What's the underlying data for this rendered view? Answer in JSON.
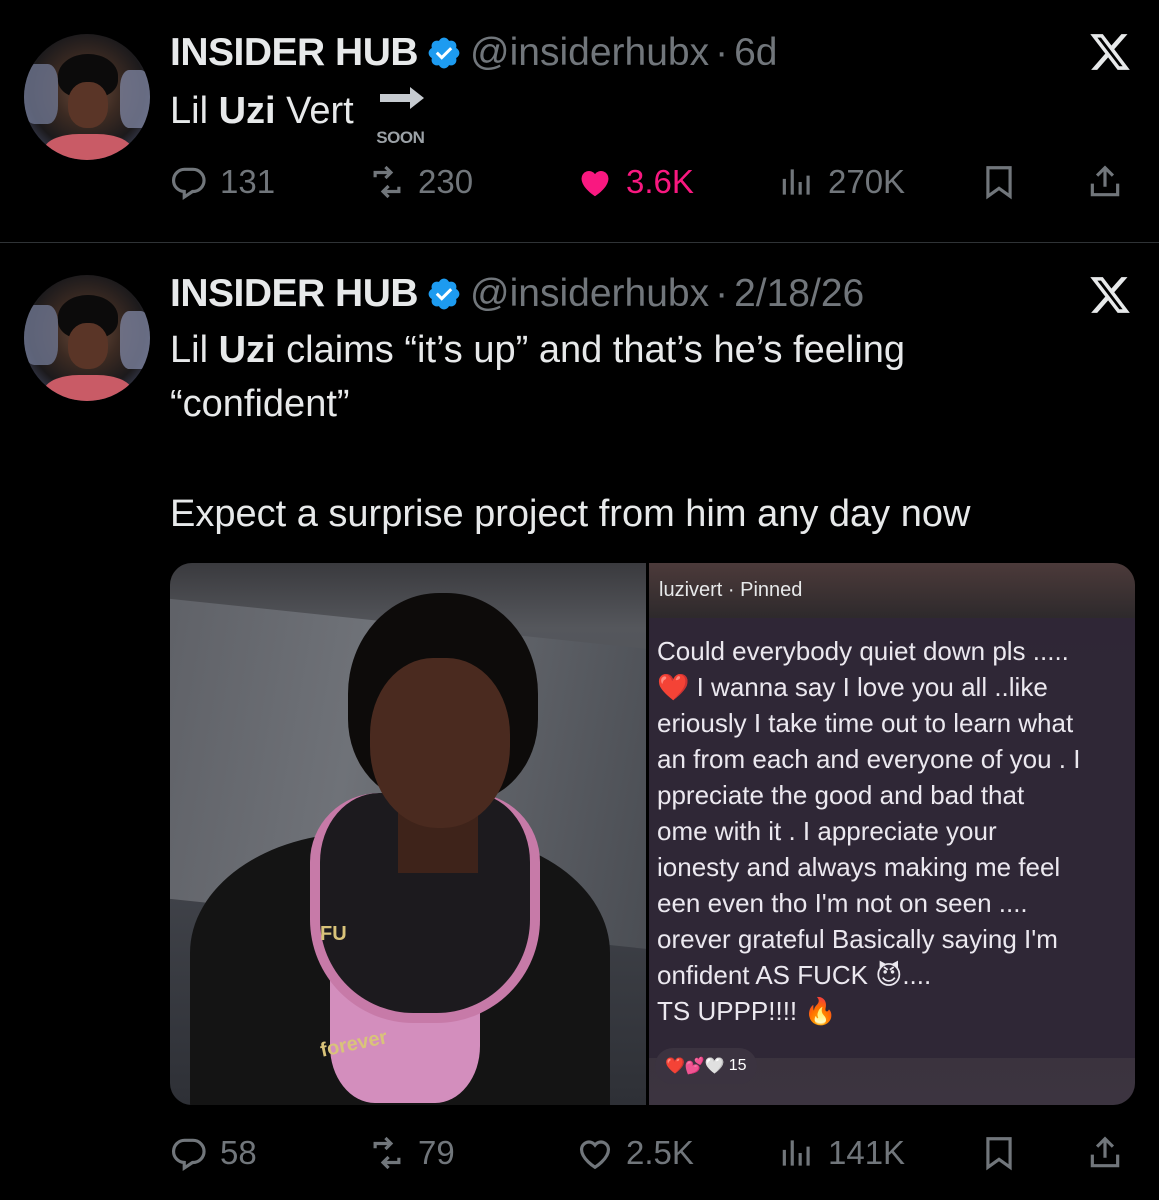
{
  "tweets": [
    {
      "author_name": "INSIDER HUB",
      "handle": "@insiderhubx",
      "separator": "·",
      "time": "6d",
      "text_pre": "Lil ",
      "text_bold": "Uzi",
      "text_post": " Vert",
      "soon_label": "SOON",
      "stats": {
        "replies": "131",
        "reposts": "230",
        "likes": "3.6K",
        "views": "270K"
      },
      "liked": true
    },
    {
      "author_name": "INSIDER HUB",
      "handle": "@insiderhubx",
      "separator": "·",
      "time": "2/18/26",
      "text_pre": "Lil ",
      "text_bold": "Uzi",
      "text_post": " claims “it’s up” and that’s he’s feeling",
      "text_line2": "“confident”",
      "text_line3": "Expect a surprise project from him any day now",
      "media": {
        "right_header": "luzivert · Pinned",
        "right_lines": [
          "Could everybody quiet down pls .....",
          "❤️ I wanna say I love you all ..like",
          "eriously I take time out to learn what",
          "an from each and everyone of you . I",
          "ppreciate the good and bad that",
          "ome with it . I appreciate your",
          "ionesty and always making me feel",
          "een even tho I'm not on seen ....",
          "orever grateful Basically saying I'm",
          "onfident AS FUCK 😈....",
          "TS UPPP!!!! 🔥"
        ],
        "reaction_count": "15",
        "shirt_text_1": "FU",
        "shirt_text_2": "forever"
      },
      "stats": {
        "replies": "58",
        "reposts": "79",
        "likes": "2.5K",
        "views": "141K"
      },
      "liked": false
    }
  ],
  "icons": {
    "reply": "speech-bubble-icon",
    "repost": "repost-arrows-icon",
    "like": "heart-icon",
    "views": "bar-chart-icon",
    "bookmark": "bookmark-icon",
    "share": "share-upload-icon",
    "brand": "x-logo-icon",
    "verified": "verified-badge-icon"
  },
  "colors": {
    "background": "#000000",
    "text": "#e7e9ea",
    "muted": "#71767b",
    "like": "#f91880",
    "verified": "#1d9bf0"
  }
}
